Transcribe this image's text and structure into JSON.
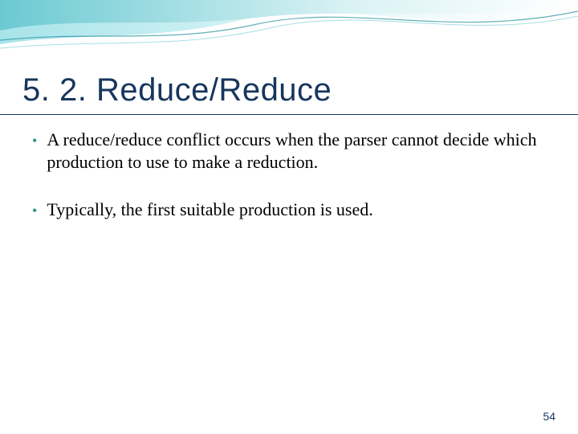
{
  "title": "5. 2.  Reduce/Reduce",
  "bullets": [
    "A reduce/reduce conflict occurs when the parser cannot decide which production to use to make a reduction.",
    "Typically, the first suitable production is used."
  ],
  "page_number": "54",
  "colors": {
    "title": "#17365d",
    "accent": "#2e8f84",
    "wave_light": "#a7e4ea",
    "wave_mid": "#6cc9d2",
    "wave_line": "#1e8d99"
  }
}
